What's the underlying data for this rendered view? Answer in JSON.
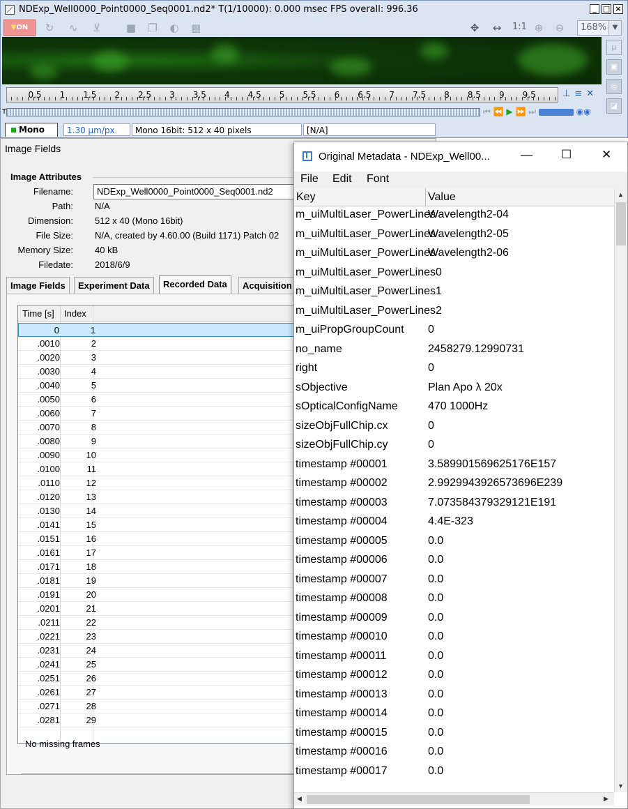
{
  "viewer": {
    "title": "NDExp_Well0000_Point0000_Seq0001.nd2*   T(1/10000): 0.000 msec   FPS overall: 996.36",
    "lut_label": "ON",
    "one_to_one": "1:1",
    "zoom": "168%",
    "ruler_ticks": [
      "0.5",
      "1",
      "1.5",
      "2",
      "2.5",
      "3",
      "3.5",
      "4",
      "4.5",
      "5",
      "5.5",
      "6",
      "6.5",
      "7",
      "7.5",
      "8",
      "8.5",
      "9",
      "9.5"
    ],
    "timeline_label": "T",
    "status": {
      "channel_tab": "Mono",
      "calibration": "1.30 µm/px",
      "format": "Mono 16bit: 512 x 40 pixels",
      "value": "[N/A]"
    }
  },
  "fields": {
    "title": "Image Fields",
    "section": "Image Attributes",
    "attributes": [
      {
        "key": "Filename:",
        "value": "NDExp_Well0000_Point0000_Seq0001.nd2"
      },
      {
        "key": "Path:",
        "value": "N/A"
      },
      {
        "key": "Dimension:",
        "value": "512 x 40 (Mono 16bit)"
      },
      {
        "key": "File Size:",
        "value": "N/A, created by 4.60.00 (Build 1171) Patch 02"
      },
      {
        "key": "Memory Size:",
        "value": "40 kB"
      },
      {
        "key": "Filedate:",
        "value": "2018/6/9"
      }
    ],
    "tabs": [
      "Image Fields",
      "Experiment Data",
      "Recorded Data",
      "Acquisition"
    ],
    "active_tab": "Recorded Data",
    "columns": [
      "Time [s]",
      "Index"
    ],
    "rows": [
      [
        "0",
        "1"
      ],
      [
        ".0010",
        "2"
      ],
      [
        ".0020",
        "3"
      ],
      [
        ".0030",
        "4"
      ],
      [
        ".0040",
        "5"
      ],
      [
        ".0050",
        "6"
      ],
      [
        ".0060",
        "7"
      ],
      [
        ".0070",
        "8"
      ],
      [
        ".0080",
        "9"
      ],
      [
        ".0090",
        "10"
      ],
      [
        ".0100",
        "11"
      ],
      [
        ".0110",
        "12"
      ],
      [
        ".0120",
        "13"
      ],
      [
        ".0130",
        "14"
      ],
      [
        ".0141",
        "15"
      ],
      [
        ".0151",
        "16"
      ],
      [
        ".0161",
        "17"
      ],
      [
        ".0171",
        "18"
      ],
      [
        ".0181",
        "19"
      ],
      [
        ".0191",
        "20"
      ],
      [
        ".0201",
        "21"
      ],
      [
        ".0211",
        "22"
      ],
      [
        ".0221",
        "23"
      ],
      [
        ".0231",
        "24"
      ],
      [
        ".0241",
        "25"
      ],
      [
        ".0251",
        "26"
      ],
      [
        ".0261",
        "27"
      ],
      [
        ".0271",
        "28"
      ],
      [
        ".0281",
        "29"
      ]
    ],
    "footer": "No missing frames"
  },
  "metadata": {
    "title": "Original Metadata - NDExp_Well00...",
    "menu": [
      "File",
      "Edit",
      "Font"
    ],
    "columns": [
      "Key",
      "Value"
    ],
    "rows": [
      [
        "m_uiMultiLaser_PowerLines",
        "Wavelength2-04"
      ],
      [
        "m_uiMultiLaser_PowerLines",
        "Wavelength2-05"
      ],
      [
        "m_uiMultiLaser_PowerLines",
        "Wavelength2-06"
      ],
      [
        "m_uiMultiLaser_PowerLines0",
        ""
      ],
      [
        "m_uiMultiLaser_PowerLines1",
        ""
      ],
      [
        "m_uiMultiLaser_PowerLines2",
        ""
      ],
      [
        "m_uiPropGroupCount",
        "0"
      ],
      [
        "no_name",
        "2458279.12990731"
      ],
      [
        "right",
        "0"
      ],
      [
        "sObjective",
        "Plan Apo λ 20x"
      ],
      [
        "sOpticalConfigName",
        "470 1000Hz"
      ],
      [
        "sizeObjFullChip.cx",
        "0"
      ],
      [
        "sizeObjFullChip.cy",
        "0"
      ],
      [
        "timestamp #00001",
        "3.589901569625176E157"
      ],
      [
        "timestamp #00002",
        "2.9929943926573696E239"
      ],
      [
        "timestamp #00003",
        "7.073584379329121E191"
      ],
      [
        "timestamp #00004",
        "4.4E-323"
      ],
      [
        "timestamp #00005",
        "0.0"
      ],
      [
        "timestamp #00006",
        "0.0"
      ],
      [
        "timestamp #00007",
        "0.0"
      ],
      [
        "timestamp #00008",
        "0.0"
      ],
      [
        "timestamp #00009",
        "0.0"
      ],
      [
        "timestamp #00010",
        "0.0"
      ],
      [
        "timestamp #00011",
        "0.0"
      ],
      [
        "timestamp #00012",
        "0.0"
      ],
      [
        "timestamp #00013",
        "0.0"
      ],
      [
        "timestamp #00014",
        "0.0"
      ],
      [
        "timestamp #00015",
        "0.0"
      ],
      [
        "timestamp #00016",
        "0.0"
      ],
      [
        "timestamp #00017",
        "0.0"
      ]
    ]
  }
}
